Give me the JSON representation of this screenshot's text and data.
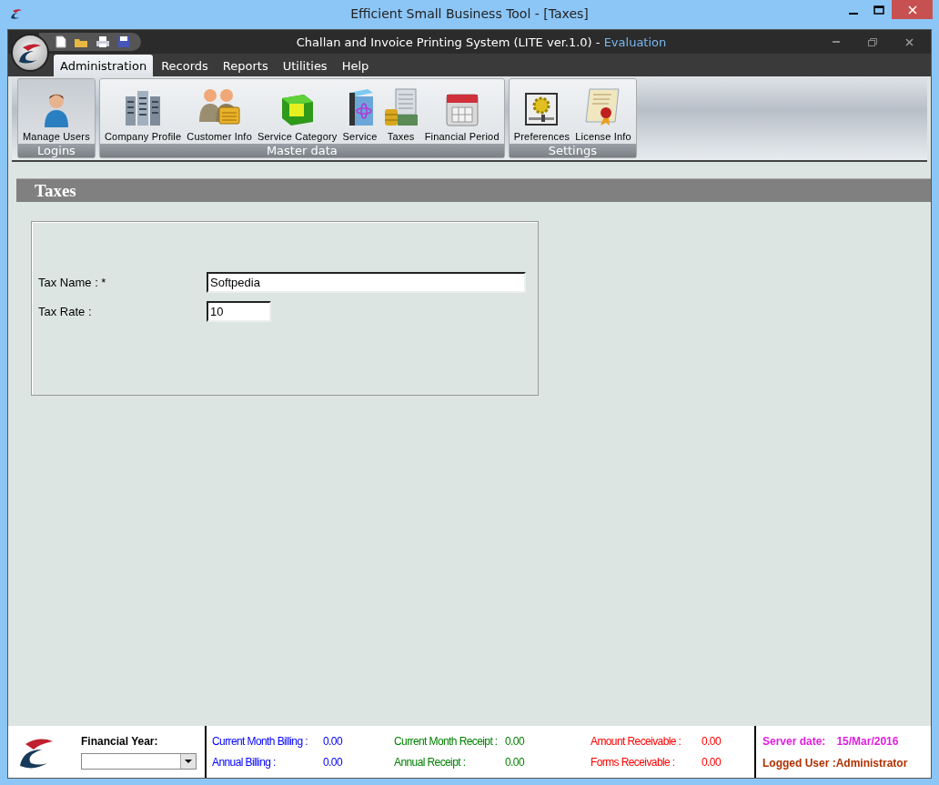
{
  "window": {
    "title": "Efficient Small Business Tool - [Taxes]"
  },
  "app": {
    "title": "Challan and Invoice Printing System (LITE ver.1.0) -",
    "edition": "Evaluation"
  },
  "menu": [
    {
      "label": "Administration",
      "selected": true
    },
    {
      "label": "Records",
      "selected": false
    },
    {
      "label": "Reports",
      "selected": false
    },
    {
      "label": "Utilities",
      "selected": false
    },
    {
      "label": "Help",
      "selected": false
    }
  ],
  "ribbon_groups": [
    {
      "caption": "Logins",
      "items": [
        {
          "label": "Manage Users",
          "kind": "user"
        }
      ]
    },
    {
      "caption": "Master data",
      "items": [
        {
          "label": "Company Profile",
          "kind": "buildings"
        },
        {
          "label": "Customer Info",
          "kind": "people"
        },
        {
          "label": "Service Category",
          "kind": "cube"
        },
        {
          "label": "Service",
          "kind": "box"
        },
        {
          "label": "Taxes",
          "kind": "money"
        },
        {
          "label": "Financial Period",
          "kind": "calendar"
        }
      ]
    },
    {
      "caption": "Settings",
      "items": [
        {
          "label": "Preferences",
          "kind": "gear"
        },
        {
          "label": "License Info",
          "kind": "certificate"
        }
      ]
    }
  ],
  "form": {
    "title": "Taxes",
    "fields": [
      {
        "label": "Tax Name : *",
        "value": "Softpedia"
      },
      {
        "label": "Tax Rate :",
        "value": "10"
      }
    ]
  },
  "status": {
    "financial_year": "Financial Year:",
    "stats": [
      {
        "label": "Current Month Billing :",
        "value": "0.00",
        "color": "#0000ff"
      },
      {
        "label": "Annual Billing :",
        "value": "0.00",
        "color": "#0000ff"
      },
      {
        "label": "Current Month Receipt :",
        "value": "0.00",
        "color": "#008000"
      },
      {
        "label": "Annual Receipt :",
        "value": "0.00",
        "color": "#008000"
      },
      {
        "label": "Amount Receivable :",
        "value": "0.00",
        "color": "#ff0000"
      },
      {
        "label": "Forms Receivable :",
        "value": "0.00",
        "color": "#ff0000"
      }
    ],
    "server_date": {
      "label": "Server date:",
      "value": "15/Mar/2016"
    },
    "logged_user": "Logged User :Administrator"
  }
}
